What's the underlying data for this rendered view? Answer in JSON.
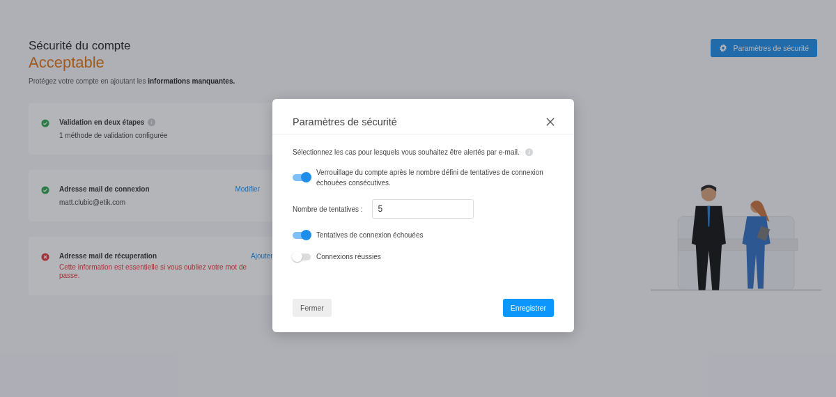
{
  "page": {
    "title": "Sécurité du compte",
    "level": "Acceptable",
    "intro": "Protégez votre compte en ajoutant les **informations manquantes.**",
    "settings_button": "Paramètres de sécurité",
    "cards": [
      {
        "kind": "ok",
        "title": "Validation en deux étapes",
        "info": true,
        "detail": "1 méthode de validation configurée"
      },
      {
        "kind": "ok",
        "title": "Adresse mail de connexion",
        "action": "Modifier",
        "detail": "matt.clubic@etik.com"
      },
      {
        "kind": "error",
        "title": "Adresse mail de récuperation",
        "action": "Ajouter",
        "warning": "Cette information est essentielle si vous oubliez votre mot de passe."
      }
    ]
  },
  "dialog": {
    "title": "Paramètres de sécurité",
    "intro": "Sélectionnez les cas pour lesquels vous souhaitez être alertés par e-mail.",
    "options": [
      {
        "kind": "toggle",
        "label": "Verrouillage du compte après le nombre défini de tentatives de connexion échouées consécutives.",
        "on": true
      },
      {
        "kind": "number",
        "label": "Nombre de tentatives :",
        "value": "5"
      },
      {
        "kind": "toggle",
        "label": "Tentatives de connexion échouées",
        "on": true
      },
      {
        "kind": "toggle",
        "label": "Connexions réussies",
        "on": false
      }
    ],
    "buttons": [
      {
        "kind": "secondary",
        "label": "Fermer"
      },
      {
        "kind": "primary",
        "label": "Enregistrer"
      }
    ]
  }
}
